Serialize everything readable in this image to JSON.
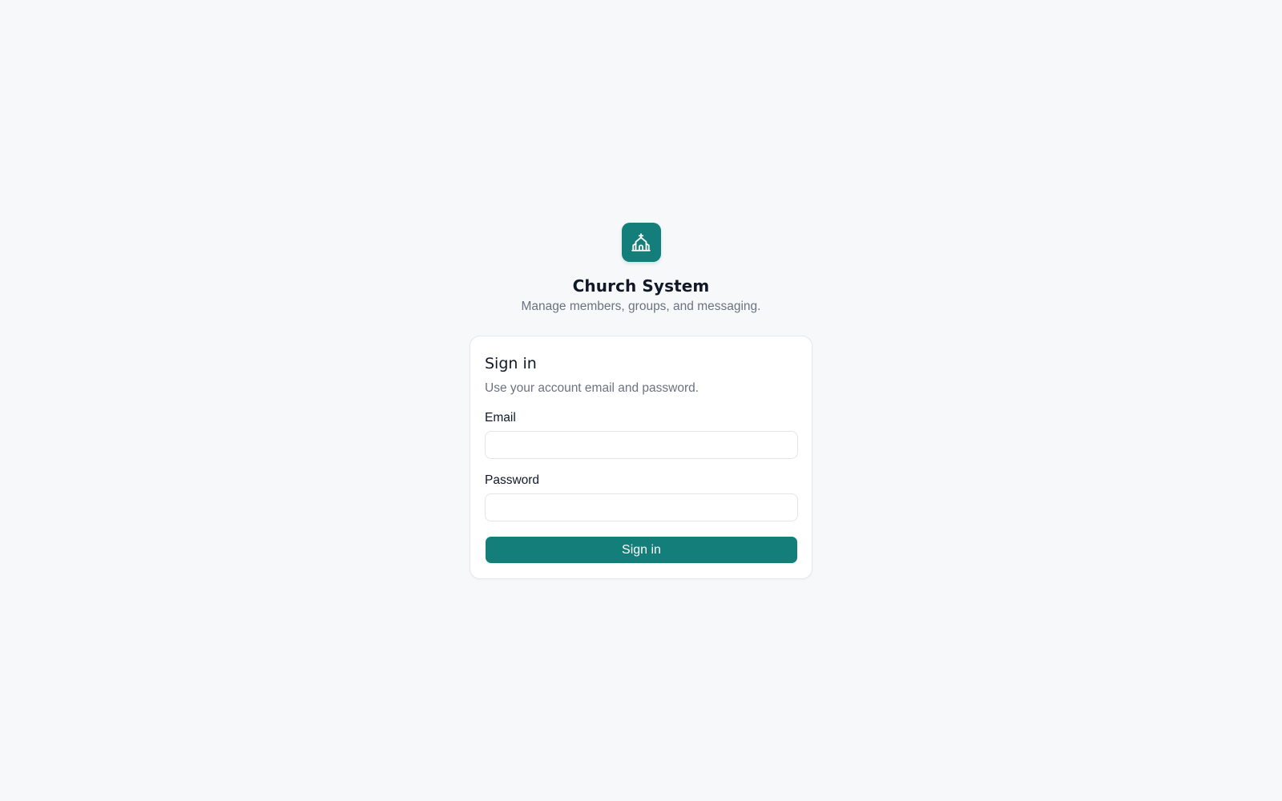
{
  "brand": {
    "icon": "church-icon",
    "title": "Church System",
    "subtitle": "Manage members, groups, and messaging."
  },
  "signin": {
    "title": "Sign in",
    "description": "Use your account email and password.",
    "email_label": "Email",
    "email_value": "",
    "email_placeholder": "",
    "password_label": "Password",
    "password_value": "",
    "password_placeholder": "",
    "submit_label": "Sign in"
  },
  "colors": {
    "accent": "#137e7a",
    "background": "#f7f8fa",
    "card": "#ffffff",
    "muted_text": "#6b7280"
  }
}
